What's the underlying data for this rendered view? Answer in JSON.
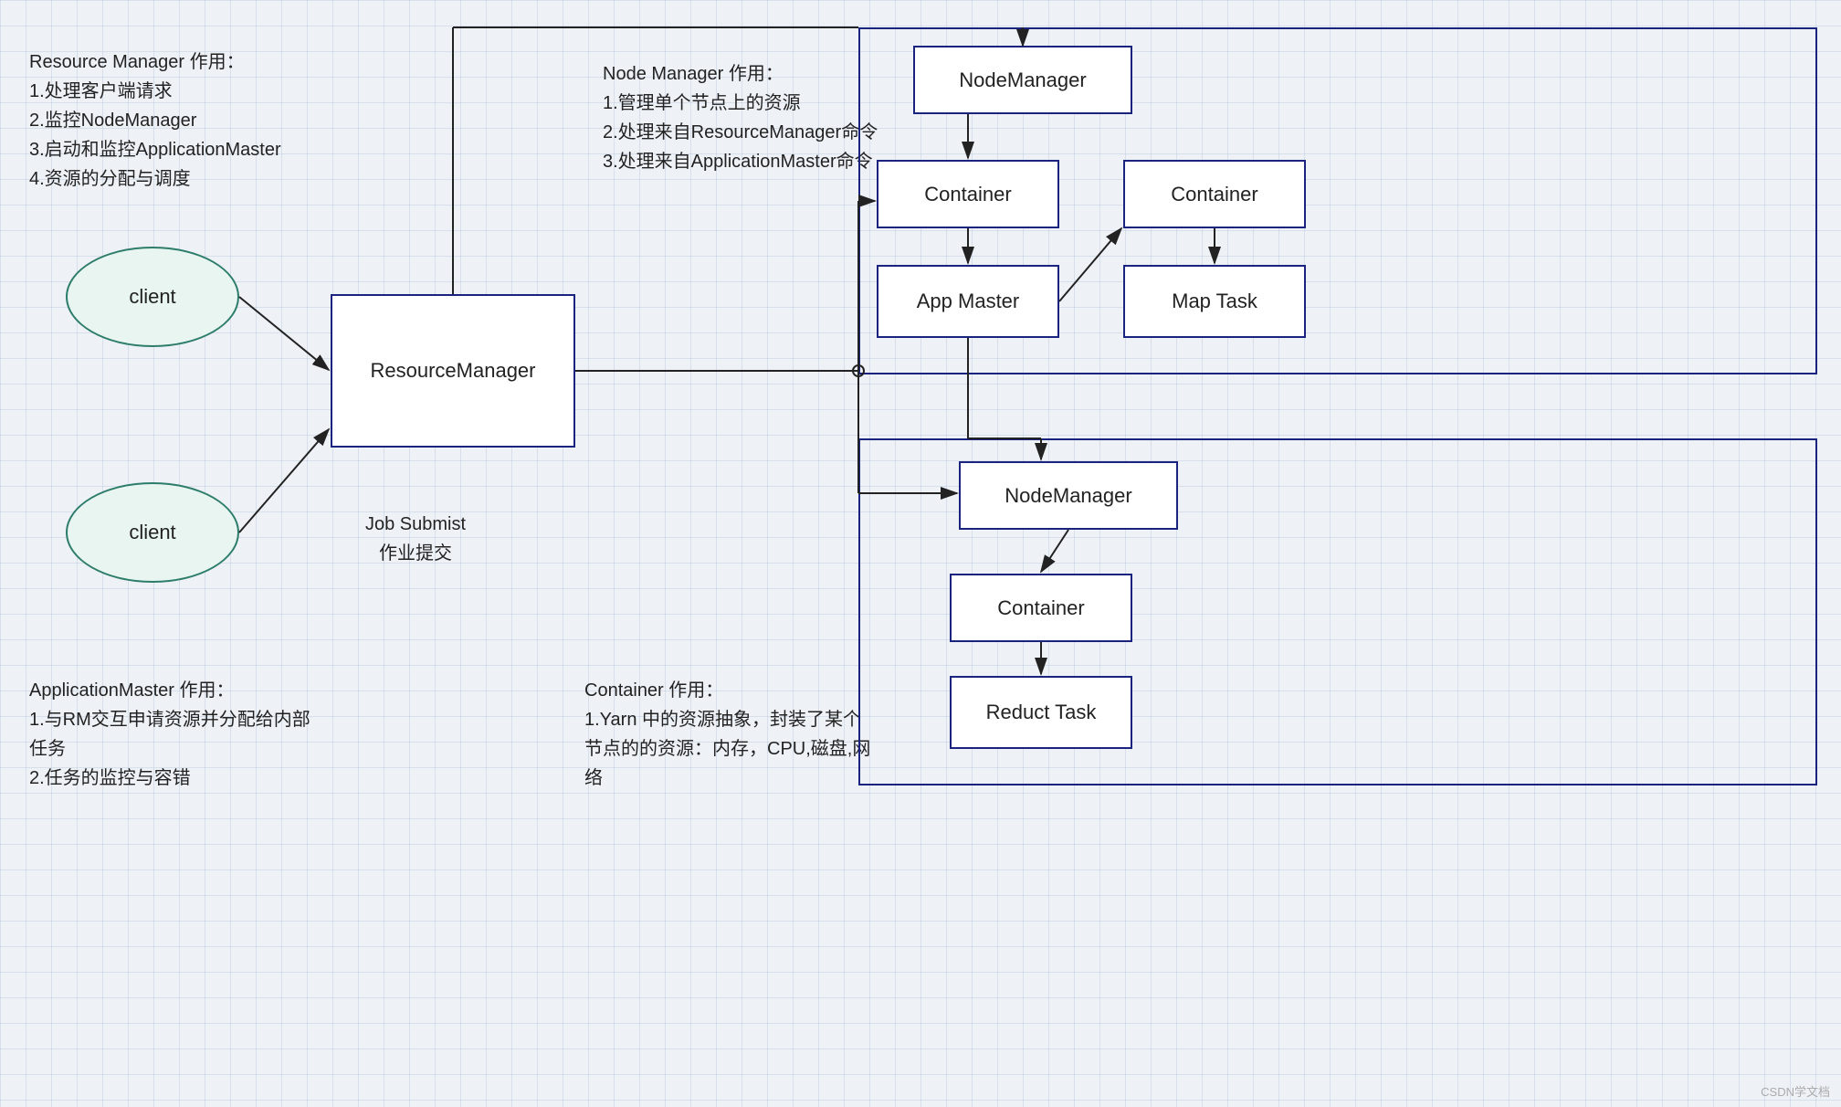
{
  "canvas": {
    "background": "#eef2f7",
    "grid_color": "rgba(180,195,215,0.4)",
    "grid_size": 28
  },
  "annotations": {
    "resource_manager": {
      "title": "Resource Manager 作用：",
      "lines": [
        "1.处理客户端请求",
        "2.监控NodeManager",
        "3.启动和监控ApplicationMaster",
        "4.资源的分配与调度"
      ]
    },
    "node_manager": {
      "title": "Node Manager 作用：",
      "lines": [
        "1.管理单个节点上的资源",
        "2.处理来自ResourceManager命令",
        "3.处理来自ApplicationMaster命令"
      ]
    },
    "application_master": {
      "title": "ApplicationMaster 作用：",
      "lines": [
        "1.与RM交互申请资源并分配给内部",
        "任务",
        "2.任务的监控与容错"
      ]
    },
    "container": {
      "title": "Container 作用：",
      "lines": [
        "1.Yarn 中的资源抽象，封装了某个",
        "节点的的资源：内存，CPU,磁盘,网",
        "络"
      ]
    },
    "job_submist": {
      "line1": "Job Submist",
      "line2": "作业提交"
    }
  },
  "boxes": {
    "resource_manager": {
      "label": "ResourceManager"
    },
    "nodemanager_top": {
      "label": "NodeManager"
    },
    "nodemanager_bottom": {
      "label": "NodeManager"
    },
    "container_top_left": {
      "label": "Container"
    },
    "container_top_right": {
      "label": "Container"
    },
    "app_master": {
      "label": "App Master"
    },
    "map_task": {
      "label": "Map Task"
    },
    "container_bottom": {
      "label": "Container"
    },
    "reduct_task": {
      "label": "Reduct Task"
    }
  },
  "ellipses": {
    "client_top": {
      "label": "client"
    },
    "client_bottom": {
      "label": "client"
    }
  },
  "watermark": "CSDN学文档"
}
